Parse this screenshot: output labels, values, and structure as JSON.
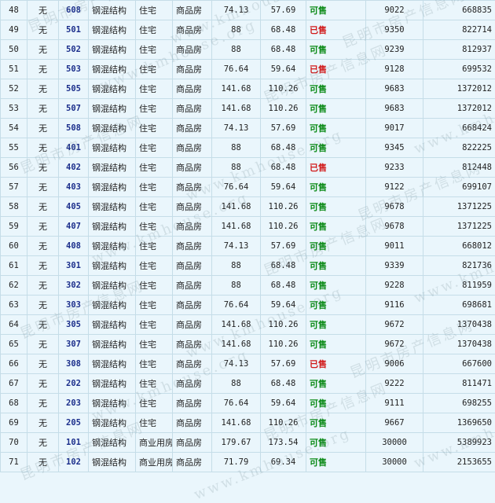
{
  "watermark": {
    "cn": "昆明市房产信息网",
    "url": "www.kmhouse.org"
  },
  "rows": [
    {
      "no": "48",
      "elevator": "无",
      "room": "608",
      "structure": "钢混结构",
      "use": "住宅",
      "type": "商品房",
      "area": "74.13",
      "inner_area": "57.69",
      "status": "可售",
      "price": "9022",
      "total": "668835"
    },
    {
      "no": "49",
      "elevator": "无",
      "room": "501",
      "structure": "钢混结构",
      "use": "住宅",
      "type": "商品房",
      "area": "88",
      "inner_area": "68.48",
      "status": "已售",
      "price": "9350",
      "total": "822714"
    },
    {
      "no": "50",
      "elevator": "无",
      "room": "502",
      "structure": "钢混结构",
      "use": "住宅",
      "type": "商品房",
      "area": "88",
      "inner_area": "68.48",
      "status": "可售",
      "price": "9239",
      "total": "812937"
    },
    {
      "no": "51",
      "elevator": "无",
      "room": "503",
      "structure": "钢混结构",
      "use": "住宅",
      "type": "商品房",
      "area": "76.64",
      "inner_area": "59.64",
      "status": "已售",
      "price": "9128",
      "total": "699532"
    },
    {
      "no": "52",
      "elevator": "无",
      "room": "505",
      "structure": "钢混结构",
      "use": "住宅",
      "type": "商品房",
      "area": "141.68",
      "inner_area": "110.26",
      "status": "可售",
      "price": "9683",
      "total": "1372012"
    },
    {
      "no": "53",
      "elevator": "无",
      "room": "507",
      "structure": "钢混结构",
      "use": "住宅",
      "type": "商品房",
      "area": "141.68",
      "inner_area": "110.26",
      "status": "可售",
      "price": "9683",
      "total": "1372012"
    },
    {
      "no": "54",
      "elevator": "无",
      "room": "508",
      "structure": "钢混结构",
      "use": "住宅",
      "type": "商品房",
      "area": "74.13",
      "inner_area": "57.69",
      "status": "可售",
      "price": "9017",
      "total": "668424"
    },
    {
      "no": "55",
      "elevator": "无",
      "room": "401",
      "structure": "钢混结构",
      "use": "住宅",
      "type": "商品房",
      "area": "88",
      "inner_area": "68.48",
      "status": "可售",
      "price": "9345",
      "total": "822225"
    },
    {
      "no": "56",
      "elevator": "无",
      "room": "402",
      "structure": "钢混结构",
      "use": "住宅",
      "type": "商品房",
      "area": "88",
      "inner_area": "68.48",
      "status": "已售",
      "price": "9233",
      "total": "812448"
    },
    {
      "no": "57",
      "elevator": "无",
      "room": "403",
      "structure": "钢混结构",
      "use": "住宅",
      "type": "商品房",
      "area": "76.64",
      "inner_area": "59.64",
      "status": "可售",
      "price": "9122",
      "total": "699107"
    },
    {
      "no": "58",
      "elevator": "无",
      "room": "405",
      "structure": "钢混结构",
      "use": "住宅",
      "type": "商品房",
      "area": "141.68",
      "inner_area": "110.26",
      "status": "可售",
      "price": "9678",
      "total": "1371225"
    },
    {
      "no": "59",
      "elevator": "无",
      "room": "407",
      "structure": "钢混结构",
      "use": "住宅",
      "type": "商品房",
      "area": "141.68",
      "inner_area": "110.26",
      "status": "可售",
      "price": "9678",
      "total": "1371225"
    },
    {
      "no": "60",
      "elevator": "无",
      "room": "408",
      "structure": "钢混结构",
      "use": "住宅",
      "type": "商品房",
      "area": "74.13",
      "inner_area": "57.69",
      "status": "可售",
      "price": "9011",
      "total": "668012"
    },
    {
      "no": "61",
      "elevator": "无",
      "room": "301",
      "structure": "钢混结构",
      "use": "住宅",
      "type": "商品房",
      "area": "88",
      "inner_area": "68.48",
      "status": "可售",
      "price": "9339",
      "total": "821736"
    },
    {
      "no": "62",
      "elevator": "无",
      "room": "302",
      "structure": "钢混结构",
      "use": "住宅",
      "type": "商品房",
      "area": "88",
      "inner_area": "68.48",
      "status": "可售",
      "price": "9228",
      "total": "811959"
    },
    {
      "no": "63",
      "elevator": "无",
      "room": "303",
      "structure": "钢混结构",
      "use": "住宅",
      "type": "商品房",
      "area": "76.64",
      "inner_area": "59.64",
      "status": "可售",
      "price": "9116",
      "total": "698681"
    },
    {
      "no": "64",
      "elevator": "无",
      "room": "305",
      "structure": "钢混结构",
      "use": "住宅",
      "type": "商品房",
      "area": "141.68",
      "inner_area": "110.26",
      "status": "可售",
      "price": "9672",
      "total": "1370438"
    },
    {
      "no": "65",
      "elevator": "无",
      "room": "307",
      "structure": "钢混结构",
      "use": "住宅",
      "type": "商品房",
      "area": "141.68",
      "inner_area": "110.26",
      "status": "可售",
      "price": "9672",
      "total": "1370438"
    },
    {
      "no": "66",
      "elevator": "无",
      "room": "308",
      "structure": "钢混结构",
      "use": "住宅",
      "type": "商品房",
      "area": "74.13",
      "inner_area": "57.69",
      "status": "已售",
      "price": "9006",
      "total": "667600"
    },
    {
      "no": "67",
      "elevator": "无",
      "room": "202",
      "structure": "钢混结构",
      "use": "住宅",
      "type": "商品房",
      "area": "88",
      "inner_area": "68.48",
      "status": "可售",
      "price": "9222",
      "total": "811471"
    },
    {
      "no": "68",
      "elevator": "无",
      "room": "203",
      "structure": "钢混结构",
      "use": "住宅",
      "type": "商品房",
      "area": "76.64",
      "inner_area": "59.64",
      "status": "可售",
      "price": "9111",
      "total": "698255"
    },
    {
      "no": "69",
      "elevator": "无",
      "room": "205",
      "structure": "钢混结构",
      "use": "住宅",
      "type": "商品房",
      "area": "141.68",
      "inner_area": "110.26",
      "status": "可售",
      "price": "9667",
      "total": "1369650"
    },
    {
      "no": "70",
      "elevator": "无",
      "room": "101",
      "structure": "钢混结构",
      "use": "商业用房",
      "type": "商品房",
      "area": "179.67",
      "inner_area": "173.54",
      "status": "可售",
      "price": "30000",
      "total": "5389923"
    },
    {
      "no": "71",
      "elevator": "无",
      "room": "102",
      "structure": "钢混结构",
      "use": "商业用房",
      "type": "商品房",
      "area": "71.79",
      "inner_area": "69.34",
      "status": "可售",
      "price": "30000",
      "total": "2153655"
    }
  ],
  "colors": {
    "background": "#eaf6fc",
    "border": "#c5dde8",
    "room_number": "#1c2f8c",
    "available": "#0a8a16",
    "sold": "#d11a1a"
  }
}
